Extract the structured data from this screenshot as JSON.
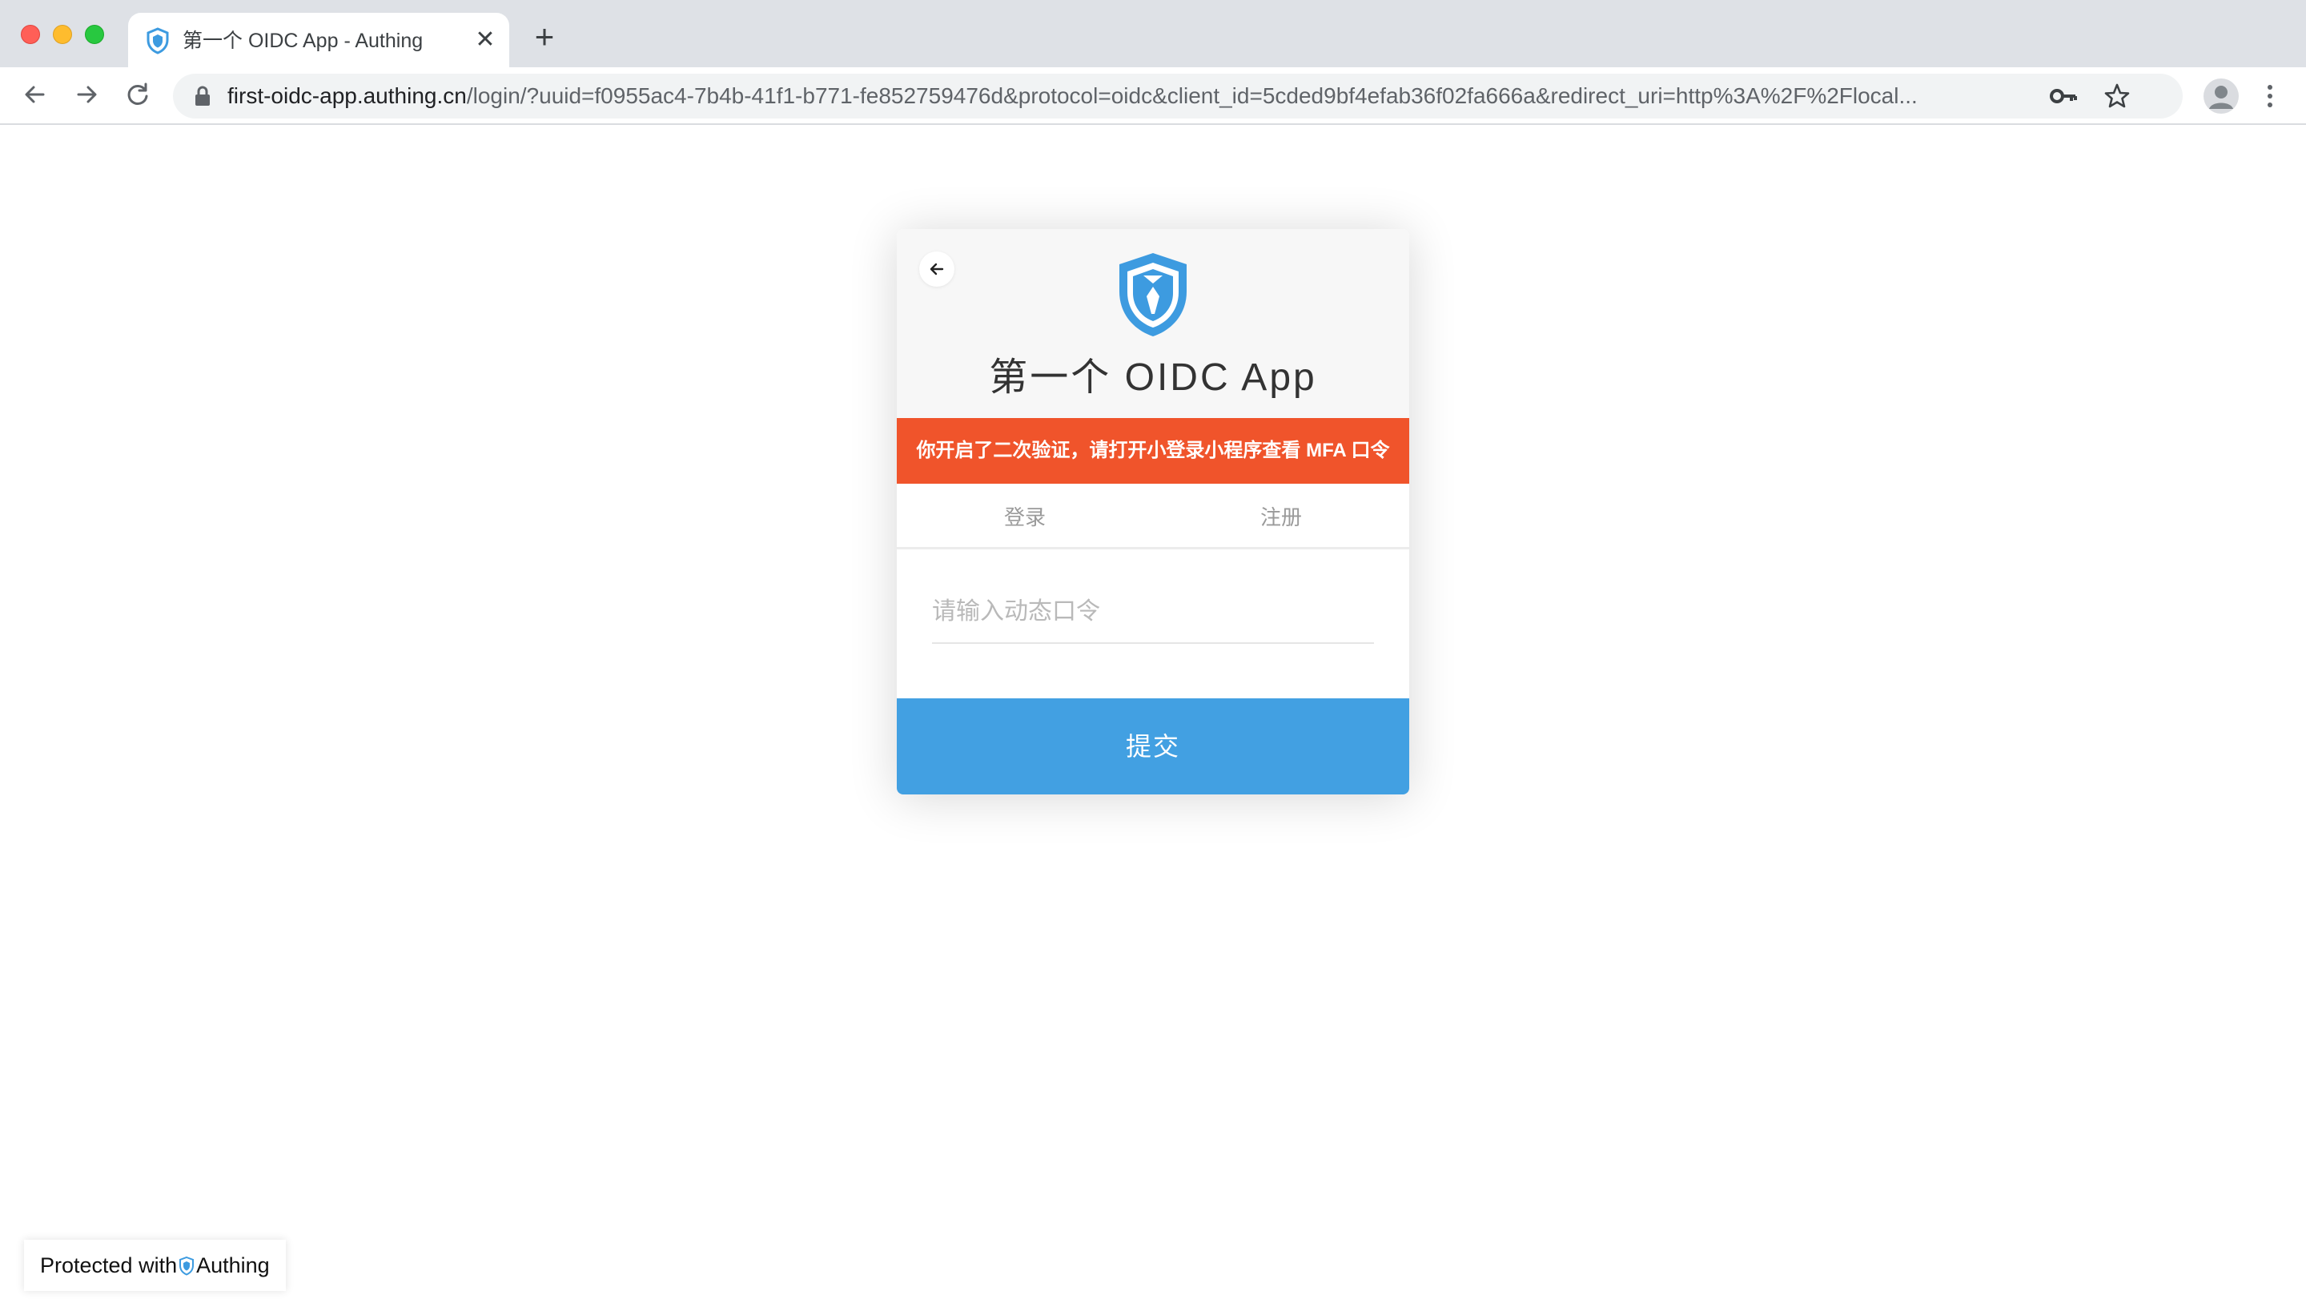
{
  "browser": {
    "tab_title": "第一个 OIDC App - Authing",
    "tab_close": "✕",
    "new_tab": "+",
    "url_host": "first-oidc-app.authing.cn",
    "url_path": "/login/?uuid=f0955ac4-7b4b-41f1-b771-fe852759476d&protocol=oidc&client_id=5cded9bf4efab36f02fa666a&redirect_uri=http%3A%2F%2Flocal..."
  },
  "login": {
    "app_title": "第一个 OIDC App",
    "alert": "你开启了二次验证，请打开小登录小程序查看 MFA 口令",
    "tabs": [
      "登录",
      "注册"
    ],
    "otp_placeholder": "请输入动态口令",
    "submit_label": "提交"
  },
  "footer": {
    "protected_prefix": "Protected with",
    "brand": "Authing"
  },
  "colors": {
    "alert": "#f0542b",
    "primary": "#42a0e2",
    "shield": "#3d9be0"
  }
}
